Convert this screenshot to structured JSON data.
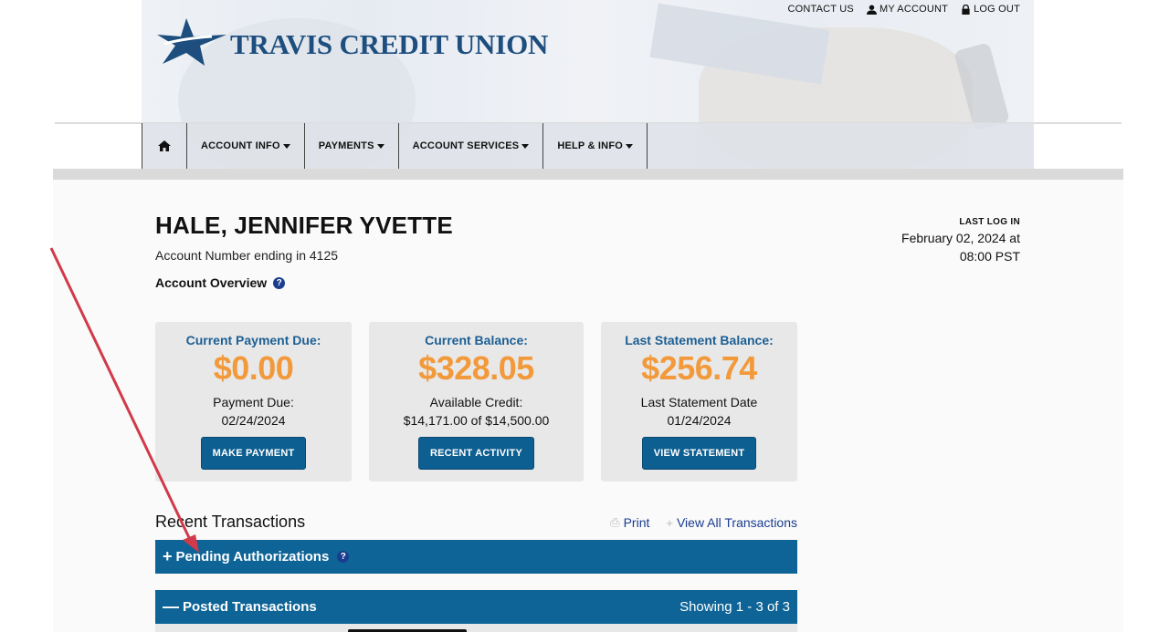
{
  "brand": {
    "name": "TRAVIS CREDIT UNION"
  },
  "utility_nav": {
    "contact": "CONTACT US",
    "my_account": "MY ACCOUNT",
    "logout": "LOG OUT"
  },
  "main_nav": {
    "items": [
      "ACCOUNT INFO",
      "PAYMENTS",
      "ACCOUNT SERVICES",
      "HELP & INFO"
    ]
  },
  "account": {
    "holder": "HALE, JENNIFER YVETTE",
    "number_text": "Account Number ending in 4125",
    "overview_label": "Account Overview"
  },
  "last_login": {
    "label": "LAST LOG IN",
    "line1": "February 02, 2024 at",
    "line2": "08:00 PST"
  },
  "cards": [
    {
      "title": "Current Payment Due:",
      "amount": "$0.00",
      "sub1": "Payment Due:",
      "sub2": "02/24/2024",
      "button": "MAKE PAYMENT"
    },
    {
      "title": "Current Balance:",
      "amount": "$328.05",
      "sub1": "Available Credit:",
      "sub2": "$14,171.00 of $14,500.00",
      "button": "RECENT ACTIVITY"
    },
    {
      "title": "Last Statement Balance:",
      "amount": "$256.74",
      "sub1": "Last Statement Date",
      "sub2": "01/24/2024",
      "button": "VIEW STATEMENT"
    }
  ],
  "recent": {
    "title": "Recent Transactions",
    "print": "Print",
    "view_all": "View All Transactions",
    "pending": "Pending Authorizations",
    "posted": "Posted Transactions",
    "showing": "Showing 1 - 3 of 3"
  },
  "colors": {
    "primary": "#0e6496",
    "accent": "#f29a3b",
    "title_blue": "#1c5f94",
    "annotation": "#d03a4a"
  }
}
